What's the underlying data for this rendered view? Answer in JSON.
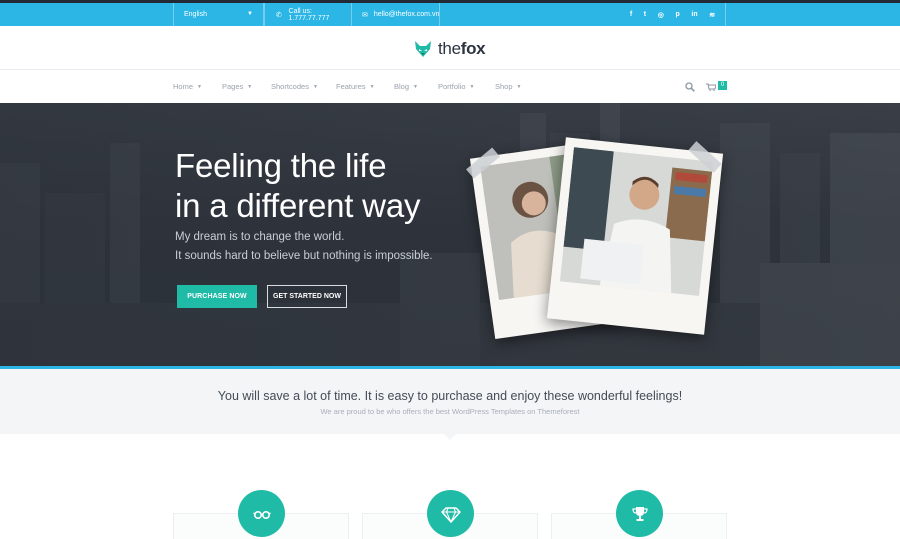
{
  "topbar": {
    "language": "English",
    "phone": "Call us: 1.777.77.777",
    "email": "hello@thefox.com.vn",
    "social_icons": [
      "facebook-icon",
      "twitter-icon",
      "dribbble-icon",
      "pinterest-icon",
      "linkedin-icon",
      "rss-icon"
    ],
    "social_glyphs": [
      "f",
      "t",
      "◎",
      "p",
      "in",
      "≋"
    ]
  },
  "brand": {
    "name_light": "the",
    "name_bold": "fox",
    "accent_color": "#1fbba6",
    "topbar_color": "#2bb6e6"
  },
  "nav": {
    "items": [
      "Home",
      "Pages",
      "Shortcodes",
      "Features",
      "Blog",
      "Portfolio",
      "Shop"
    ],
    "cart_count": "0"
  },
  "hero": {
    "title_line1": "Feeling the life",
    "title_line2": "in a different way",
    "subtitle_line1": "My dream is to change the world.",
    "subtitle_line2": "It sounds hard to believe but nothing is impossible.",
    "primary_button": "PURCHASE NOW",
    "secondary_button": "GET STARTED NOW"
  },
  "intro": {
    "title": "You will save a lot of time. It is easy to purchase and enjoy these wonderful feelings!",
    "subtitle": "We are proud to be who offers the best WordPress Templates on Themeforest"
  },
  "features": [
    {
      "icon": "glasses-icon"
    },
    {
      "icon": "diamond-icon"
    },
    {
      "icon": "trophy-icon"
    }
  ]
}
